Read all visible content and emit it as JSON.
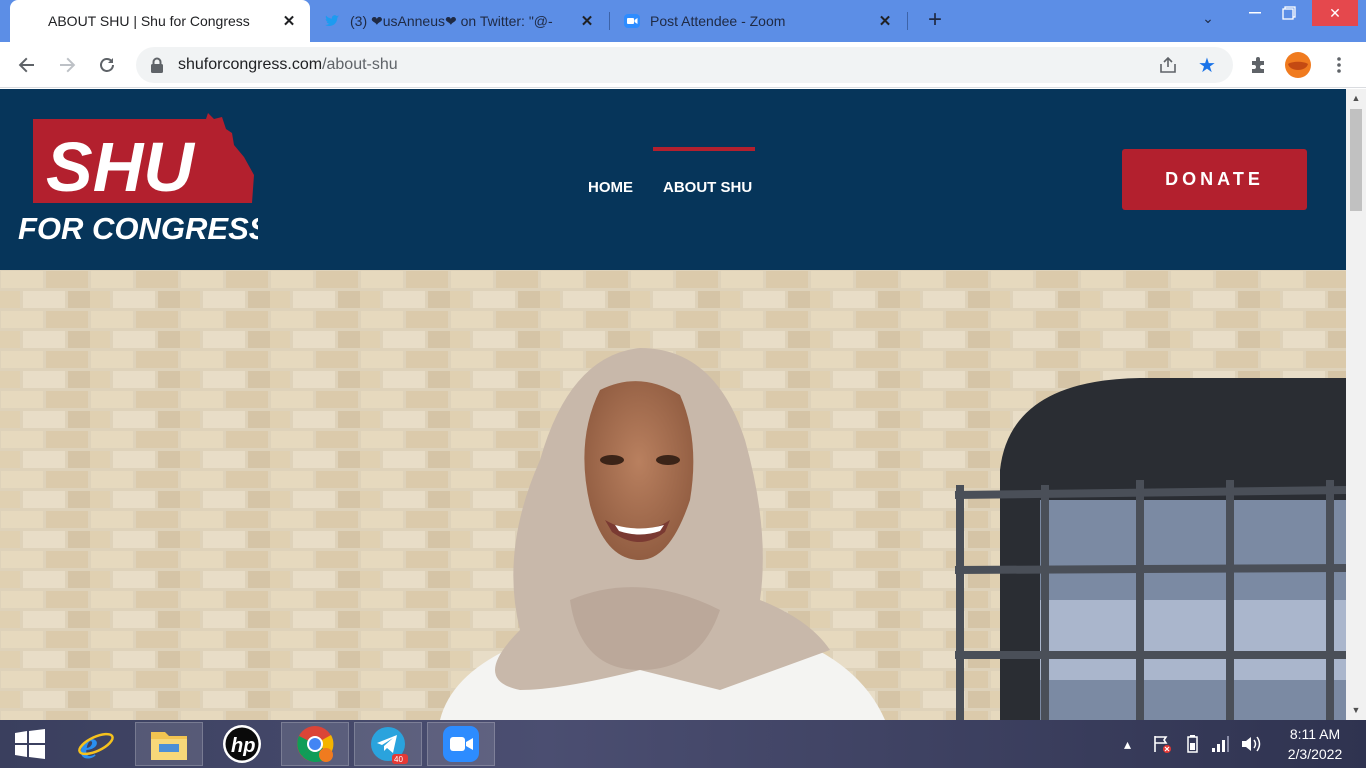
{
  "browser": {
    "tabs": [
      {
        "title": "ABOUT SHU | Shu for Congress",
        "active": true
      },
      {
        "title": "(3) ❤usAnneus❤ on Twitter: \"@-",
        "active": false
      },
      {
        "title": "Post Attendee - Zoom",
        "active": false
      }
    ],
    "url_domain": "shuforcongress.com",
    "url_path": "/about-shu"
  },
  "site": {
    "logo_top": "SHU",
    "logo_bottom": "FOR CONGRESS",
    "nav": {
      "home": "HOME",
      "about": "ABOUT SHU"
    },
    "donate": "DONATE",
    "colors": {
      "navy": "#06355a",
      "red": "#b3202e"
    }
  },
  "taskbar": {
    "telegram_badge": "40",
    "time": "8:11 AM",
    "date": "2/3/2022"
  }
}
